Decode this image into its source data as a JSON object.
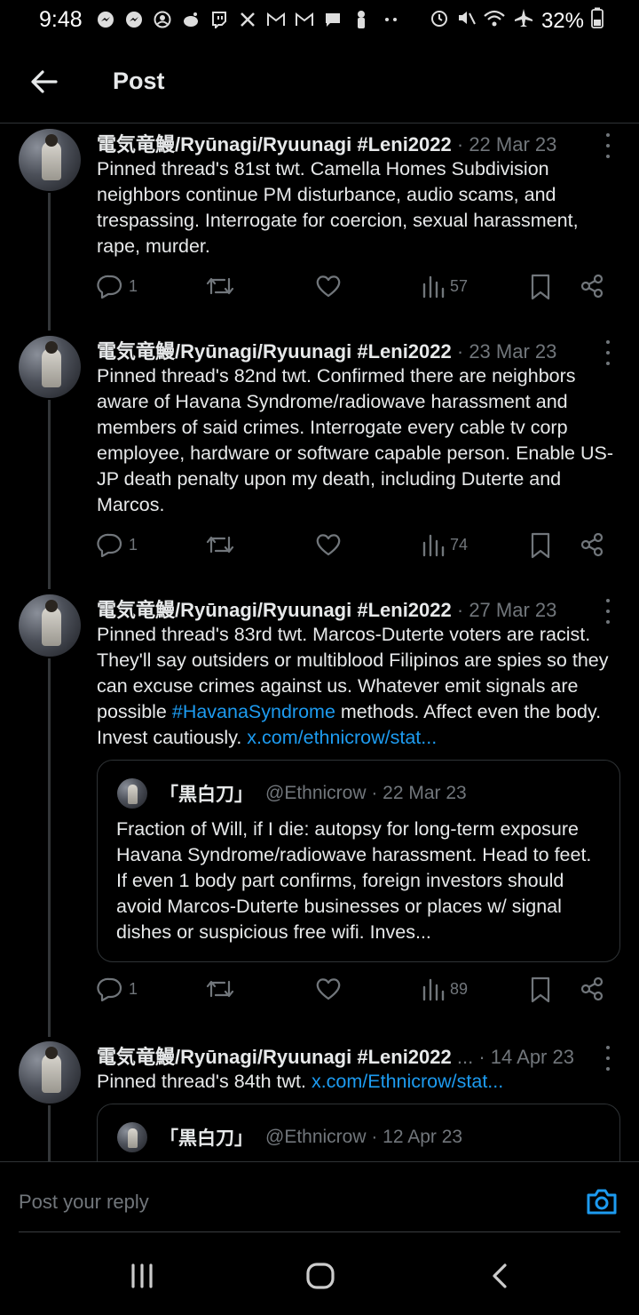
{
  "status_bar": {
    "time": "9:48",
    "battery": "32%",
    "notification_icons": [
      "messenger-icon",
      "messenger-icon",
      "account-icon",
      "reddit-icon",
      "twitch-icon",
      "x-icon",
      "gmail-icon",
      "gmail-icon",
      "chat-icon",
      "figure-icon",
      "more-dots-icon"
    ],
    "system_icons": [
      "alarm-icon",
      "mute-icon",
      "wifi-icon",
      "airplane-icon",
      "battery-icon"
    ]
  },
  "header": {
    "title": "Post",
    "back_icon": "arrow-left-icon"
  },
  "posts": [
    {
      "name": "電気竜鰻/Ryūnagi/Ryuunagi #Leni2022",
      "date": "· 22 Mar 23",
      "text": "Pinned thread's 81st twt. Camella Homes Subdivision neighbors continue PM disturbance, audio scams, and trespassing. Interrogate for coercion, sexual harassment, rape, murder.",
      "replies": "1",
      "views": "57"
    },
    {
      "name": "電気竜鰻/Ryūnagi/Ryuunagi #Leni2022",
      "date": "· 23 Mar 23",
      "text": "Pinned thread's 82nd twt. Confirmed there are neighbors aware of Havana Syndrome/radiowave harassment and members of said crimes. Interrogate every cable tv corp employee, hardware or software capable person. Enable US-JP death penalty upon my death, including Duterte and Marcos.",
      "replies": "1",
      "views": "74"
    },
    {
      "name": "電気竜鰻/Ryūnagi/Ryuunagi #Leni2022",
      "date": "· 27 Mar 23",
      "text_before": "Pinned thread's 83rd twt. Marcos-Duterte voters are racist. They'll say outsiders or multiblood Filipinos are spies so they can excuse crimes against us. Whatever emit signals are possible ",
      "hashtag": "#HavanaSyndrome",
      "text_after": " methods. Affect even the body. Invest cautiously. ",
      "link": "x.com/ethnicrow/stat...",
      "quote": {
        "name": "「黒白刀」",
        "handle": "@Ethnicrow · 22 Mar 23",
        "text": "Fraction of Will, if I die: autopsy for long-term exposure Havana Syndrome/radiowave harassment. Head to feet. If even 1 body part confirms, foreign investors should avoid Marcos-Duterte businesses or places w/ signal dishes or suspicious free wifi. Inves..."
      },
      "replies": "1",
      "views": "89"
    },
    {
      "name": "電気竜鰻/Ryūnagi/Ryuunagi #Leni2022",
      "name_ellipsis": "...",
      "date": "· 14 Apr 23",
      "text": "Pinned thread's 84th twt. ",
      "link": "x.com/Ethnicrow/stat...",
      "quote": {
        "name": "「黒白刀」",
        "handle": "@Ethnicrow · 12 Apr 23"
      }
    }
  ],
  "reply_bar": {
    "placeholder": "Post your reply",
    "camera_icon": "camera-icon"
  },
  "nav_bar": {
    "buttons": [
      "recents-icon",
      "home-icon",
      "back-icon"
    ]
  },
  "colors": {
    "background": "#000000",
    "text": "#e7e9ea",
    "muted": "#71767b",
    "link": "#1d9bf0",
    "divider": "#2f3336"
  }
}
